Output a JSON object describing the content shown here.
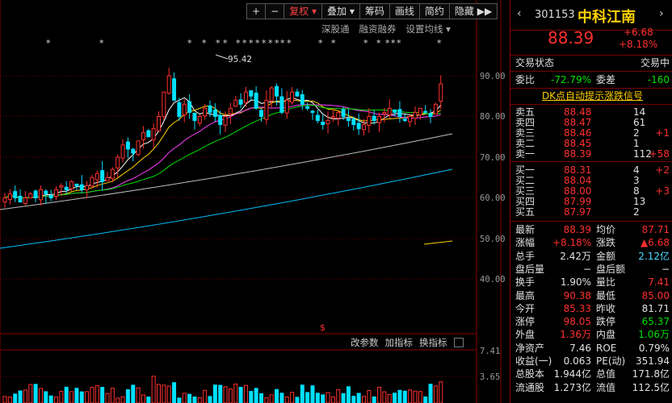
{
  "toolbar": {
    "plus": "+",
    "minus": "−",
    "fuquan": "复权",
    "diejia": "叠加",
    "chouma": "筹码",
    "huaxian": "画线",
    "jianyue": "简约",
    "yincang": "隐藏",
    "arrows": "▶▶"
  },
  "subbar": {
    "shengutong": "深股通",
    "rongzi": "融资融券",
    "settings": "设置均线"
  },
  "volbar": {
    "change": "改参数",
    "add": "加指标",
    "swap": "换指标"
  },
  "peak_label": "95.42",
  "y_axis": [
    "90.00",
    "80.00",
    "70.00",
    "60.00",
    "50.00",
    "40.00"
  ],
  "vol_axis": [
    "7.41",
    "3.65"
  ],
  "dollar": "$",
  "colors": {
    "up": "#ff3030",
    "down": "#00e0ff",
    "ma5": "#ffffff",
    "ma10": "#ffd200",
    "ma20": "#ff40ff",
    "ma30": "#00e000",
    "ma60": "#c0c0c0",
    "ma120": "#00c0ff"
  },
  "stock": {
    "code": "301153",
    "name": "中科江南",
    "price": "88.39",
    "change": "+6.68",
    "pct": "+8.18%"
  },
  "header_row": {
    "left": "交易状态",
    "right": "交易中"
  },
  "weibi": {
    "l1": "委比",
    "v1": "-72.79%",
    "l2": "委差",
    "v2": "-160"
  },
  "dk_link": "DK点自动提示涨跌信号",
  "asks": [
    {
      "label": "卖五",
      "price": "88.48",
      "vol": "14",
      "chg": ""
    },
    {
      "label": "卖四",
      "price": "88.47",
      "vol": "61",
      "chg": ""
    },
    {
      "label": "卖三",
      "price": "88.46",
      "vol": "2",
      "chg": "+1"
    },
    {
      "label": "卖二",
      "price": "88.45",
      "vol": "1",
      "chg": ""
    },
    {
      "label": "卖一",
      "price": "88.39",
      "vol": "112",
      "chg": "+58"
    }
  ],
  "bids": [
    {
      "label": "买一",
      "price": "88.31",
      "vol": "4",
      "chg": "+2"
    },
    {
      "label": "买二",
      "price": "88.04",
      "vol": "3",
      "chg": ""
    },
    {
      "label": "买三",
      "price": "88.00",
      "vol": "8",
      "chg": "+3"
    },
    {
      "label": "买四",
      "price": "87.99",
      "vol": "13",
      "chg": ""
    },
    {
      "label": "买五",
      "price": "87.97",
      "vol": "2",
      "chg": ""
    }
  ],
  "stats": [
    {
      "l1": "最新",
      "v1": "88.39",
      "c1": "red",
      "l2": "均价",
      "v2": "87.71",
      "c2": "red"
    },
    {
      "l1": "涨幅",
      "v1": "+8.18%",
      "c1": "red",
      "l2": "涨跌",
      "v2": "▲6.68",
      "c2": "red"
    },
    {
      "l1": "总手",
      "v1": "2.42万",
      "c1": "white",
      "l2": "金额",
      "v2": "2.12亿",
      "c2": "cyan"
    },
    {
      "l1": "盘后量",
      "v1": "−",
      "c1": "white",
      "l2": "盘后额",
      "v2": "−",
      "c2": "white"
    },
    {
      "l1": "换手",
      "v1": "1.90%",
      "c1": "white",
      "l2": "量比",
      "v2": "7.41",
      "c2": "red"
    },
    {
      "l1": "最高",
      "v1": "90.38",
      "c1": "red",
      "l2": "最低",
      "v2": "85.00",
      "c2": "red"
    },
    {
      "l1": "今开",
      "v1": "85.33",
      "c1": "red",
      "l2": "昨收",
      "v2": "81.71",
      "c2": "white"
    },
    {
      "l1": "涨停",
      "v1": "98.05",
      "c1": "red",
      "l2": "跌停",
      "v2": "65.37",
      "c2": "green"
    },
    {
      "l1": "外盘",
      "v1": "1.36万",
      "c1": "red",
      "l2": "内盘",
      "v2": "1.06万",
      "c2": "green"
    },
    {
      "l1": "净资产",
      "v1": "7.46",
      "c1": "white",
      "l2": "ROE",
      "v2": "0.79%",
      "c2": "white"
    },
    {
      "l1": "收益(一)",
      "v1": "0.063",
      "c1": "white",
      "l2": "PE(动)",
      "v2": "351.94",
      "c2": "white"
    },
    {
      "l1": "总股本",
      "v1": "1.944亿",
      "c1": "white",
      "l2": "总值",
      "v2": "171.8亿",
      "c2": "white"
    },
    {
      "l1": "流通股",
      "v1": "1.273亿",
      "c1": "white",
      "l2": "流值",
      "v2": "112.5亿",
      "c2": "white"
    }
  ]
}
